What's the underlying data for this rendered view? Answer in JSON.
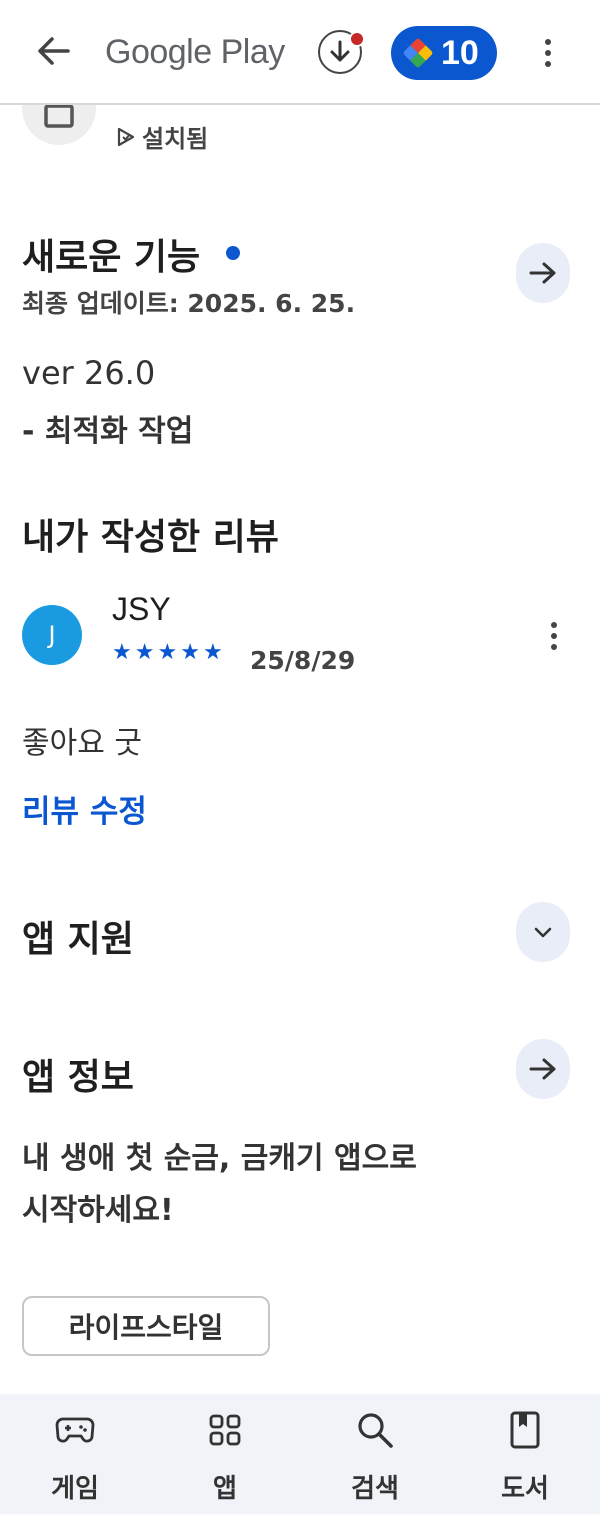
{
  "header": {
    "title": "Google Play",
    "points": "10"
  },
  "app": {
    "installed_label": "설치됨"
  },
  "whats_new": {
    "title": "새로운 기능",
    "last_updated": "최종 업데이트: 2025. 6. 25.",
    "version": "ver 26.0",
    "notes": "- 최적화 작업"
  },
  "my_review": {
    "title": "내가 작성한 리뷰",
    "avatar_letter": "J",
    "user": "JSY",
    "rating": 5,
    "date": "25/8/29",
    "text": "좋아요 굿",
    "edit_label": "리뷰 수정"
  },
  "app_support": {
    "title": "앱 지원"
  },
  "app_info": {
    "title": "앱 정보",
    "description_line1": "내 생애 첫 순금, 금캐기 앱으로",
    "description_line2": "시작하세요!",
    "category": "라이프스타일"
  },
  "bottom_nav": [
    {
      "label": "게임",
      "icon": "gamepad-icon"
    },
    {
      "label": "앱",
      "icon": "apps-grid-icon"
    },
    {
      "label": "검색",
      "icon": "search-icon"
    },
    {
      "label": "도서",
      "icon": "book-icon"
    }
  ],
  "colors": {
    "accent": "#0b57d0",
    "avatar": "#1a9be1",
    "nav_bg": "#f0f4f9"
  }
}
